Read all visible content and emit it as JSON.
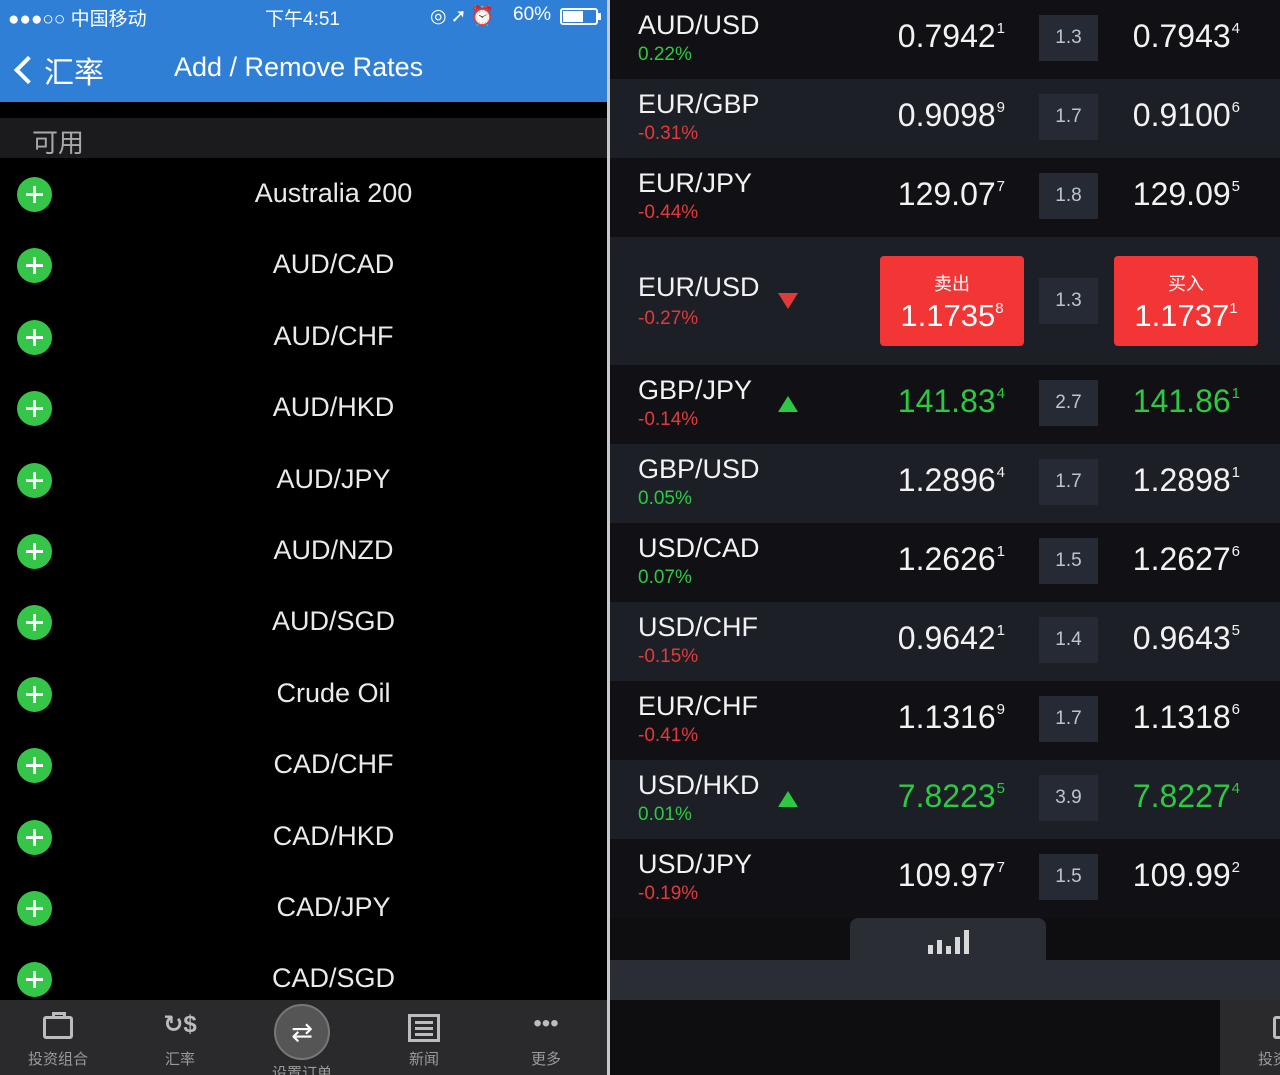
{
  "status": {
    "carrier": "●●●○○ 中国移动",
    "time": "下午4:51",
    "battery": "60%"
  },
  "nav": {
    "back_label": "汇率",
    "title": "Add / Remove Rates"
  },
  "section": {
    "title": "可用"
  },
  "available": [
    "Australia 200",
    "AUD/CAD",
    "AUD/CHF",
    "AUD/HKD",
    "AUD/JPY",
    "AUD/NZD",
    "AUD/SGD",
    "Crude Oil",
    "CAD/CHF",
    "CAD/HKD",
    "CAD/JPY",
    "CAD/SGD"
  ],
  "tabs": [
    {
      "label": "投资组合",
      "icon": "briefcase-icon"
    },
    {
      "label": "汇率",
      "icon": "exchange-rate-icon"
    },
    {
      "label": "设置订单",
      "icon": "set-order-icon"
    },
    {
      "label": "新闻",
      "icon": "news-icon"
    },
    {
      "label": "更多",
      "icon": "more-icon"
    }
  ],
  "trade": {
    "sell_label": "卖出",
    "buy_label": "买入"
  },
  "colors": {
    "header_blue": "#2f7fd6",
    "add_green": "#35c548",
    "up_green": "#2ec942",
    "down_red": "#e23a3a",
    "trade_red": "#f23535"
  },
  "quotes": [
    {
      "symbol": "AUD/USD",
      "change": "0.22%",
      "direction": "pos",
      "bid": "0.7942",
      "bid_sup": "1",
      "spread": "1.3",
      "ask": "0.7943",
      "ask_sup": "4"
    },
    {
      "symbol": "EUR/GBP",
      "change": "-0.31%",
      "direction": "neg",
      "bid": "0.9098",
      "bid_sup": "9",
      "spread": "1.7",
      "ask": "0.9100",
      "ask_sup": "6"
    },
    {
      "symbol": "EUR/JPY",
      "change": "-0.44%",
      "direction": "neg",
      "bid": "129.07",
      "bid_sup": "7",
      "spread": "1.8",
      "ask": "129.09",
      "ask_sup": "5"
    },
    {
      "symbol": "EUR/USD",
      "change": "-0.27%",
      "direction": "neg",
      "bid": "1.1735",
      "bid_sup": "8",
      "spread": "1.3",
      "ask": "1.1737",
      "ask_sup": "1",
      "trend": "down",
      "selected": true
    },
    {
      "symbol": "GBP/JPY",
      "change": "-0.14%",
      "direction": "neg",
      "bid": "141.83",
      "bid_sup": "4",
      "spread": "2.7",
      "ask": "141.86",
      "ask_sup": "1",
      "trend": "up"
    },
    {
      "symbol": "GBP/USD",
      "change": "0.05%",
      "direction": "pos",
      "bid": "1.2896",
      "bid_sup": "4",
      "spread": "1.7",
      "ask": "1.2898",
      "ask_sup": "1"
    },
    {
      "symbol": "USD/CAD",
      "change": "0.07%",
      "direction": "pos",
      "bid": "1.2626",
      "bid_sup": "1",
      "spread": "1.5",
      "ask": "1.2627",
      "ask_sup": "6"
    },
    {
      "symbol": "USD/CHF",
      "change": "-0.15%",
      "direction": "neg",
      "bid": "0.9642",
      "bid_sup": "1",
      "spread": "1.4",
      "ask": "0.9643",
      "ask_sup": "5"
    },
    {
      "symbol": "EUR/CHF",
      "change": "-0.41%",
      "direction": "neg",
      "bid": "1.1316",
      "bid_sup": "9",
      "spread": "1.7",
      "ask": "1.1318",
      "ask_sup": "6"
    },
    {
      "symbol": "USD/HKD",
      "change": "0.01%",
      "direction": "pos",
      "bid": "7.8223",
      "bid_sup": "5",
      "spread": "3.9",
      "ask": "7.8227",
      "ask_sup": "4",
      "trend": "up"
    },
    {
      "symbol": "USD/JPY",
      "change": "-0.19%",
      "direction": "neg",
      "bid": "109.97",
      "bid_sup": "7",
      "spread": "1.5",
      "ask": "109.99",
      "ask_sup": "2"
    }
  ]
}
